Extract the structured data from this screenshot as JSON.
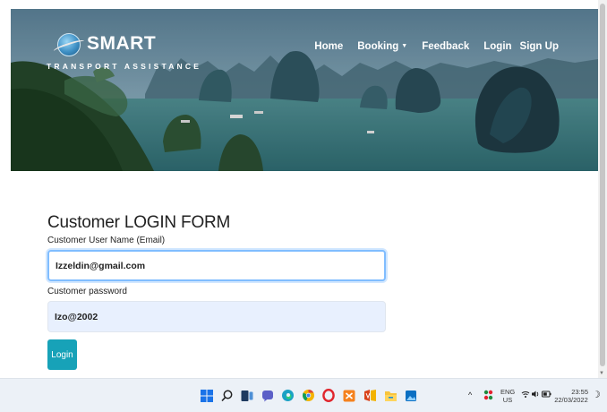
{
  "brand": {
    "name": "SMART",
    "tagline": "TRANSPORT ASSISTANCE"
  },
  "nav": {
    "home": "Home",
    "booking": "Booking",
    "feedback": "Feedback",
    "login": "Login",
    "signup": "Sign Up"
  },
  "form": {
    "title": "Customer LOGIN FORM",
    "email_label": "Customer User Name (Email)",
    "email_value": "Izzeldin@gmail.com",
    "password_label": "Customer password",
    "password_value": "Izo@2002",
    "submit_label": "Login"
  },
  "taskbar": {
    "icons": [
      "windows-start-icon",
      "search-icon",
      "task-view-icon",
      "chat-icon",
      "edge-icon",
      "chrome-icon",
      "opera-icon",
      "xampp-icon",
      "office-icon",
      "file-explorer-icon",
      "photos-icon"
    ],
    "tray": {
      "caret": "^",
      "language_top": "ENG",
      "language_bottom": "US",
      "time": "23:55",
      "date": "22/03/2022"
    }
  },
  "colors": {
    "accent": "#17a2b8",
    "input_focus": "#80bdff",
    "autofill": "#e8f0fe"
  }
}
